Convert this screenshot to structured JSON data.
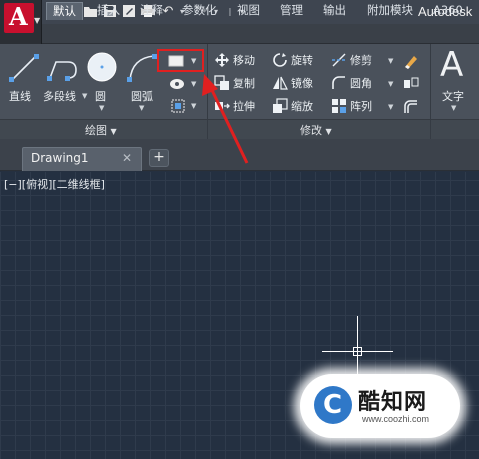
{
  "window": {
    "title": "Autodesk"
  },
  "tabs": [
    {
      "label": "默认",
      "active": true
    },
    {
      "label": "插入"
    },
    {
      "label": "注释"
    },
    {
      "label": "参数化"
    },
    {
      "label": "视图"
    },
    {
      "label": "管理"
    },
    {
      "label": "输出"
    },
    {
      "label": "附加模块"
    },
    {
      "label": "A360"
    }
  ],
  "draw_panel": {
    "title": "绘图",
    "tools": [
      {
        "label": "直线",
        "icon": "line-icon"
      },
      {
        "label": "多段线",
        "icon": "polyline-icon"
      },
      {
        "label": "圆",
        "icon": "circle-icon"
      },
      {
        "label": "圆弧",
        "icon": "arc-icon"
      }
    ],
    "small_tools": [
      {
        "icon": "rectangle-icon"
      },
      {
        "icon": "hatch-icon"
      },
      {
        "icon": "boundary-icon"
      }
    ]
  },
  "modify_panel": {
    "title": "修改",
    "tools": [
      {
        "label": "移动",
        "icon": "move-icon"
      },
      {
        "label": "旋转",
        "icon": "rotate-icon"
      },
      {
        "label": "修剪",
        "icon": "trim-icon"
      },
      {
        "label": "复制",
        "icon": "copy-icon"
      },
      {
        "label": "镜像",
        "icon": "mirror-icon"
      },
      {
        "label": "圆角",
        "icon": "fillet-icon"
      },
      {
        "label": "拉伸",
        "icon": "stretch-icon"
      },
      {
        "label": "缩放",
        "icon": "scale-icon"
      },
      {
        "label": "阵列",
        "icon": "array-icon"
      }
    ]
  },
  "annotation_panel": {
    "tool_label": "文字"
  },
  "file_tabs": {
    "active_label": "Drawing1",
    "close": "✕",
    "new": "+"
  },
  "viewport": {
    "label": "[−][俯视][二维线框]"
  },
  "watermark": {
    "title": "酷知网",
    "url": "www.coozhi.com",
    "badge": "C"
  },
  "colors": {
    "highlight": "#e02020",
    "canvas_bg": "#243041",
    "ribbon_bg": "#4a515b"
  }
}
